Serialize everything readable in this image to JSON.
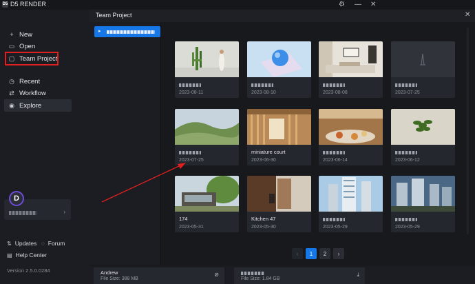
{
  "app": {
    "title": "D5 RENDER",
    "logo_text": "D5"
  },
  "window_controls": {
    "settings_icon": "⚙",
    "minimize": "—",
    "close": "✕"
  },
  "sidebar": {
    "items": [
      {
        "label": "New",
        "icon": "+"
      },
      {
        "label": "Open",
        "icon": "▭"
      },
      {
        "label": "Team Project",
        "icon": "▢"
      },
      {
        "label": "Recent",
        "icon": "◷"
      },
      {
        "label": "Workflow",
        "icon": "⇄"
      },
      {
        "label": "Explore",
        "icon": "◉"
      }
    ],
    "avatar_letter": "D",
    "footer": {
      "updates": "Updates",
      "forum": "Forum",
      "help": "Help Center"
    },
    "version": "Version 2.5.0.0284"
  },
  "panel": {
    "title": "Team Project",
    "close": "✕"
  },
  "projects": [
    {
      "title": "",
      "date": "2023-08-11",
      "thumb": "cactus"
    },
    {
      "title": "",
      "date": "2023-08-10",
      "thumb": "sphere"
    },
    {
      "title": "",
      "date": "2023-08-08",
      "thumb": "livingroom"
    },
    {
      "title": "",
      "date": "2023-07-25",
      "thumb": "placeholder"
    },
    {
      "title": "",
      "date": "2023-07-25",
      "thumb": "hills"
    },
    {
      "title": "miniature court",
      "date": "2023-06-30",
      "thumb": "court"
    },
    {
      "title": "",
      "date": "2023-06-14",
      "thumb": "restaurant"
    },
    {
      "title": "",
      "date": "2023-06-12",
      "thumb": "plant"
    },
    {
      "title": "174",
      "date": "2023-05-31",
      "thumb": "house"
    },
    {
      "title": "Kitchen 47",
      "date": "2023-05-30",
      "thumb": "kitchen"
    },
    {
      "title": "",
      "date": "2023-05-29",
      "thumb": "tower"
    },
    {
      "title": "",
      "date": "2023-05-29",
      "thumb": "city"
    }
  ],
  "pagination": {
    "prev": "‹",
    "pages": [
      "1",
      "2"
    ],
    "next": "›",
    "current": "1"
  },
  "tasks": [
    {
      "user": "Andrew",
      "size": "File Size: 388 MB",
      "icon": "⊘"
    },
    {
      "user": "",
      "size": "File Size: 1.84 GB",
      "icon": "⤓"
    }
  ],
  "colors": {
    "accent": "#1677e8",
    "highlight": "#e01f1f"
  }
}
